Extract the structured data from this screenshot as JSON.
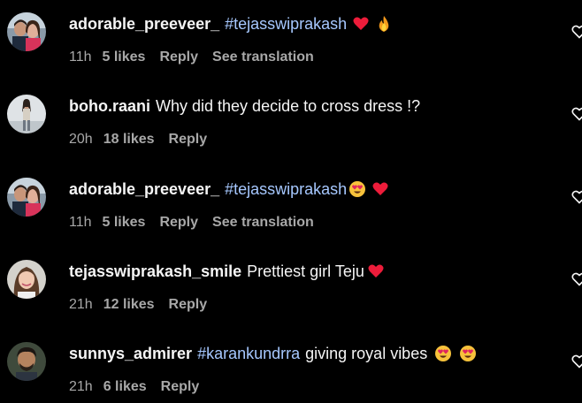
{
  "colors": {
    "background": "#000000",
    "text": "#f5f5f5",
    "muted": "#a8a8a8",
    "hashtag": "#a6c8ff",
    "heart": "#ed1c3a"
  },
  "comments": [
    {
      "username": "adorable_preeveer_",
      "hashtag": "#tejasswiprakash",
      "text": "",
      "emojis": [
        "red-heart-emoji",
        "fire-emoji"
      ],
      "time": "11h",
      "likes": "5 likes",
      "reply": "Reply",
      "translation": "See translation"
    },
    {
      "username": "boho.raani",
      "hashtag": "",
      "text": "Why did they decide to cross dress !?",
      "emojis": [],
      "time": "20h",
      "likes": "18 likes",
      "reply": "Reply",
      "translation": ""
    },
    {
      "username": "adorable_preeveer_",
      "hashtag": "#tejasswiprakash",
      "text": "",
      "emojis": [
        "heart-eyes-emoji",
        "red-heart-emoji"
      ],
      "time": "11h",
      "likes": "5 likes",
      "reply": "Reply",
      "translation": "See translation"
    },
    {
      "username": "tejasswiprakash_smile",
      "hashtag": "",
      "text": "Prettiest girl Teju",
      "emojis": [
        "red-heart-emoji"
      ],
      "time": "21h",
      "likes": "12 likes",
      "reply": "Reply",
      "translation": ""
    },
    {
      "username": "sunnys_admirer",
      "hashtag": "#karankundrra",
      "text": "giving royal vibes",
      "emojis": [
        "heart-eyes-emoji",
        "heart-eyes-emoji"
      ],
      "time": "21h",
      "likes": "6 likes",
      "reply": "Reply",
      "translation": ""
    }
  ]
}
